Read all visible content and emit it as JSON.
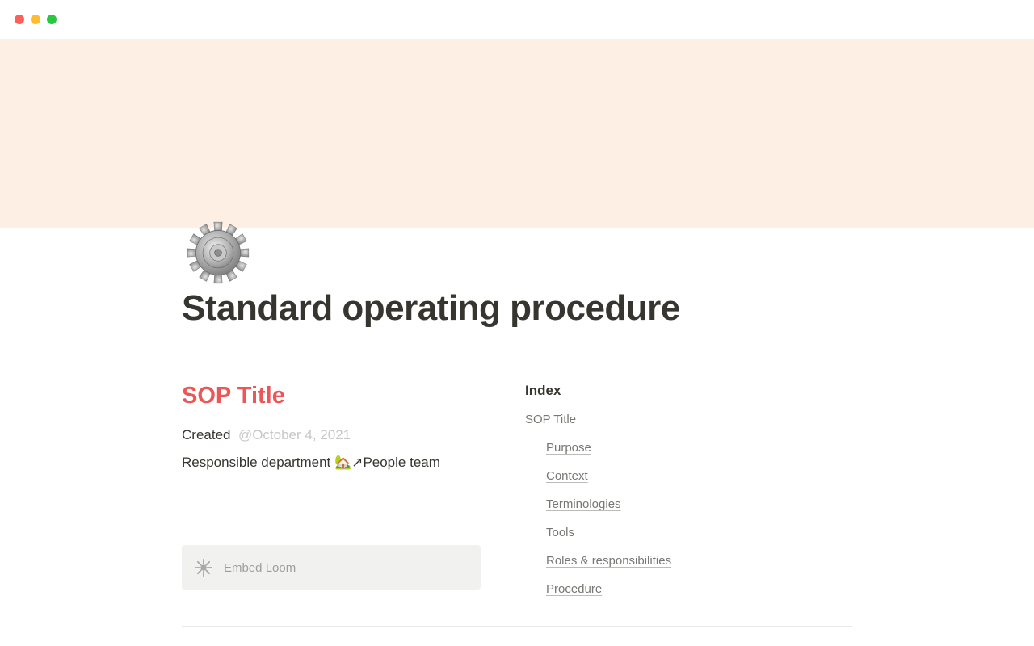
{
  "page": {
    "icon_name": "gear-icon",
    "title": "Standard operating procedure"
  },
  "sop": {
    "title": "SOP Title",
    "created_label": "Created",
    "created_date": "@October 4, 2021",
    "responsible_label": "Responsible department ",
    "responsible_link_emoji": "🏡↗",
    "responsible_link_text": "People team"
  },
  "embed": {
    "label": "Embed Loom"
  },
  "index": {
    "heading": "Index",
    "top": "SOP Title",
    "items": [
      "Purpose",
      "Context",
      "Terminologies",
      "Tools",
      "Roles & responsibilities",
      "Procedure"
    ]
  }
}
